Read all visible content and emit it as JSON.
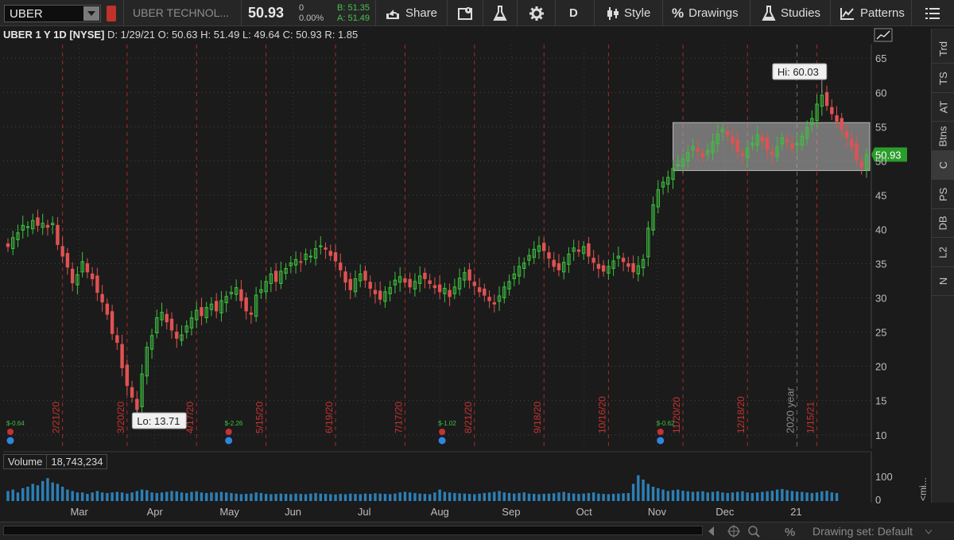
{
  "toolbar": {
    "symbol": "UBER",
    "company": "UBER TECHNOL...",
    "last_price": "50.93",
    "net_change": "0",
    "pct_change": "0.00%",
    "bid": "B: 51.35",
    "ask": "A: 51.49",
    "share_label": "Share",
    "aggregation": "D",
    "style_label": "Style",
    "drawings_label": "Drawings",
    "studies_label": "Studies",
    "patterns_label": "Patterns"
  },
  "chart_header": {
    "title": "UBER 1 Y 1D [NYSE]",
    "date": "D: 1/29/21",
    "open": "O: 50.63",
    "high": "H: 51.49",
    "low": "L: 49.64",
    "close": "C: 50.93",
    "range": "R: 1.85"
  },
  "sidebar": {
    "tabs": [
      "Trd",
      "TS",
      "AT",
      "Btns",
      "C",
      "PS",
      "DB",
      "L2",
      "N"
    ],
    "active": "C"
  },
  "volume_panel": {
    "label": "Volume",
    "value": "18,743,234",
    "axis_ticks": [
      "100",
      "0"
    ],
    "axis_label": "<mi..."
  },
  "bottom_bar": {
    "drawing_set": "Drawing set: Default"
  },
  "chart_data": {
    "type": "candlestick",
    "ylim": [
      8,
      67
    ],
    "y_ticks": [
      10,
      15,
      20,
      25,
      30,
      35,
      40,
      45,
      50,
      55,
      60,
      65
    ],
    "x_month_labels": [
      "Mar",
      "Apr",
      "May",
      "Jun",
      "Jul",
      "Aug",
      "Sep",
      "Oct",
      "Nov",
      "Dec",
      "21"
    ],
    "date_markers": [
      "2/21/20",
      "3/20/20",
      "4/17/20",
      "5/15/20",
      "6/19/20",
      "7/17/20",
      "8/21/20",
      "9/18/20",
      "10/16/20",
      "11/20/20",
      "12/18/20",
      "1/15/21"
    ],
    "year_marker": "2020 year",
    "low_label": "Lo: 13.71",
    "high_label": "Hi: 60.03",
    "price_bubble": "50.93",
    "rectangle": {
      "y_low": 48.6,
      "y_high": 55.6
    },
    "earnings": [
      "$-0.64",
      "$-2.26",
      "$-1.02",
      "$-0.62"
    ],
    "closes": [
      37.5,
      38.8,
      39.5,
      40.6,
      40.4,
      41.3,
      40.6,
      40.9,
      40.3,
      40.9,
      37.8,
      36.1,
      34.5,
      32.2,
      33.4,
      35.3,
      33.8,
      32.8,
      30.8,
      29.4,
      27.6,
      24.8,
      23.5,
      19.8,
      17.2,
      15.5,
      13.71,
      18.9,
      22.8,
      24.5,
      27.1,
      27.9,
      26.5,
      25.3,
      24.1,
      24.6,
      25.9,
      27.1,
      28.2,
      27.4,
      28.6,
      29.1,
      28.1,
      29.6,
      30.2,
      30.8,
      31.5,
      29.6,
      28.1,
      27.6,
      30.4,
      31.2,
      32.4,
      33.5,
      32.4,
      33.9,
      34.3,
      35.1,
      35.6,
      35.2,
      36.4,
      36.1,
      37.2,
      37.6,
      37.1,
      36.2,
      35.4,
      34.1,
      32.3,
      31.2,
      32.8,
      33.5,
      32.6,
      31.4,
      30.6,
      29.8,
      30.9,
      31.5,
      32.6,
      33.1,
      32.3,
      31.6,
      32.4,
      33.2,
      32.8,
      32.1,
      31.5,
      30.9,
      31.4,
      30.2,
      31.6,
      32.9,
      33.7,
      32.6,
      31.8,
      30.9,
      30.4,
      29.6,
      29.1,
      30.3,
      31.6,
      32.4,
      33.5,
      34.6,
      35.1,
      36.2,
      37.1,
      37.6,
      36.9,
      35.8,
      34.6,
      34.1,
      35.2,
      36.4,
      37.3,
      36.8,
      37.5,
      36.1,
      35.2,
      34.3,
      33.9,
      34.6,
      35.4,
      36.1,
      35.3,
      34.6,
      33.8,
      34.7,
      35.6,
      40.2,
      43.6,
      45.8,
      46.9,
      47.6,
      48.9,
      49.5,
      50.3,
      51.2,
      52.1,
      51.4,
      50.6,
      51.5,
      52.8,
      53.9,
      54.6,
      53.8,
      52.6,
      51.4,
      50.8,
      51.9,
      52.6,
      53.8,
      52.9,
      51.6,
      50.9,
      52.1,
      53.4,
      52.8,
      51.9,
      52.6,
      53.6,
      54.9,
      56.2,
      58.3,
      59.6,
      58.1,
      56.9,
      55.8,
      54.6,
      53.4,
      52.1,
      50.2,
      49.1,
      50.93
    ],
    "volume_levels": [
      0.35,
      0.4,
      0.3,
      0.45,
      0.5,
      0.6,
      0.55,
      0.7,
      0.8,
      0.65,
      0.6,
      0.5,
      0.4,
      0.35,
      0.3,
      0.3,
      0.25,
      0.3,
      0.35,
      0.3,
      0.28,
      0.3,
      0.32,
      0.3,
      0.26,
      0.3,
      0.35,
      0.4,
      0.38,
      0.3,
      0.28,
      0.3,
      0.32,
      0.35,
      0.34,
      0.3,
      0.28,
      0.32,
      0.34,
      0.3,
      0.28,
      0.3,
      0.3,
      0.32,
      0.3,
      0.28,
      0.26,
      0.24,
      0.25,
      0.26,
      0.3,
      0.28,
      0.25,
      0.24,
      0.25,
      0.26,
      0.25,
      0.24,
      0.26,
      0.25,
      0.24,
      0.26,
      0.28,
      0.26,
      0.25,
      0.24,
      0.23,
      0.25,
      0.24,
      0.26,
      0.25,
      0.24,
      0.26,
      0.25,
      0.27,
      0.26,
      0.25,
      0.24,
      0.26,
      0.3,
      0.32,
      0.3,
      0.28,
      0.26,
      0.25,
      0.24,
      0.3,
      0.4,
      0.32,
      0.3,
      0.28,
      0.27,
      0.26,
      0.25,
      0.24,
      0.26,
      0.28,
      0.3,
      0.32,
      0.35,
      0.3,
      0.28,
      0.26,
      0.28,
      0.3,
      0.26,
      0.25,
      0.24,
      0.25,
      0.26,
      0.27,
      0.3,
      0.32,
      0.28,
      0.26,
      0.25,
      0.26,
      0.28,
      0.3,
      0.26,
      0.25,
      0.24,
      0.25,
      0.26,
      0.27,
      0.28,
      0.6,
      0.9,
      0.75,
      0.6,
      0.5,
      0.45,
      0.4,
      0.35,
      0.38,
      0.4,
      0.36,
      0.34,
      0.32,
      0.33,
      0.34,
      0.3,
      0.32,
      0.34,
      0.3,
      0.28,
      0.3,
      0.32,
      0.34,
      0.3,
      0.28,
      0.3,
      0.32,
      0.34,
      0.36,
      0.4,
      0.42,
      0.38,
      0.35,
      0.33,
      0.32,
      0.3,
      0.28,
      0.3,
      0.34,
      0.36,
      0.3,
      0.28
    ]
  }
}
